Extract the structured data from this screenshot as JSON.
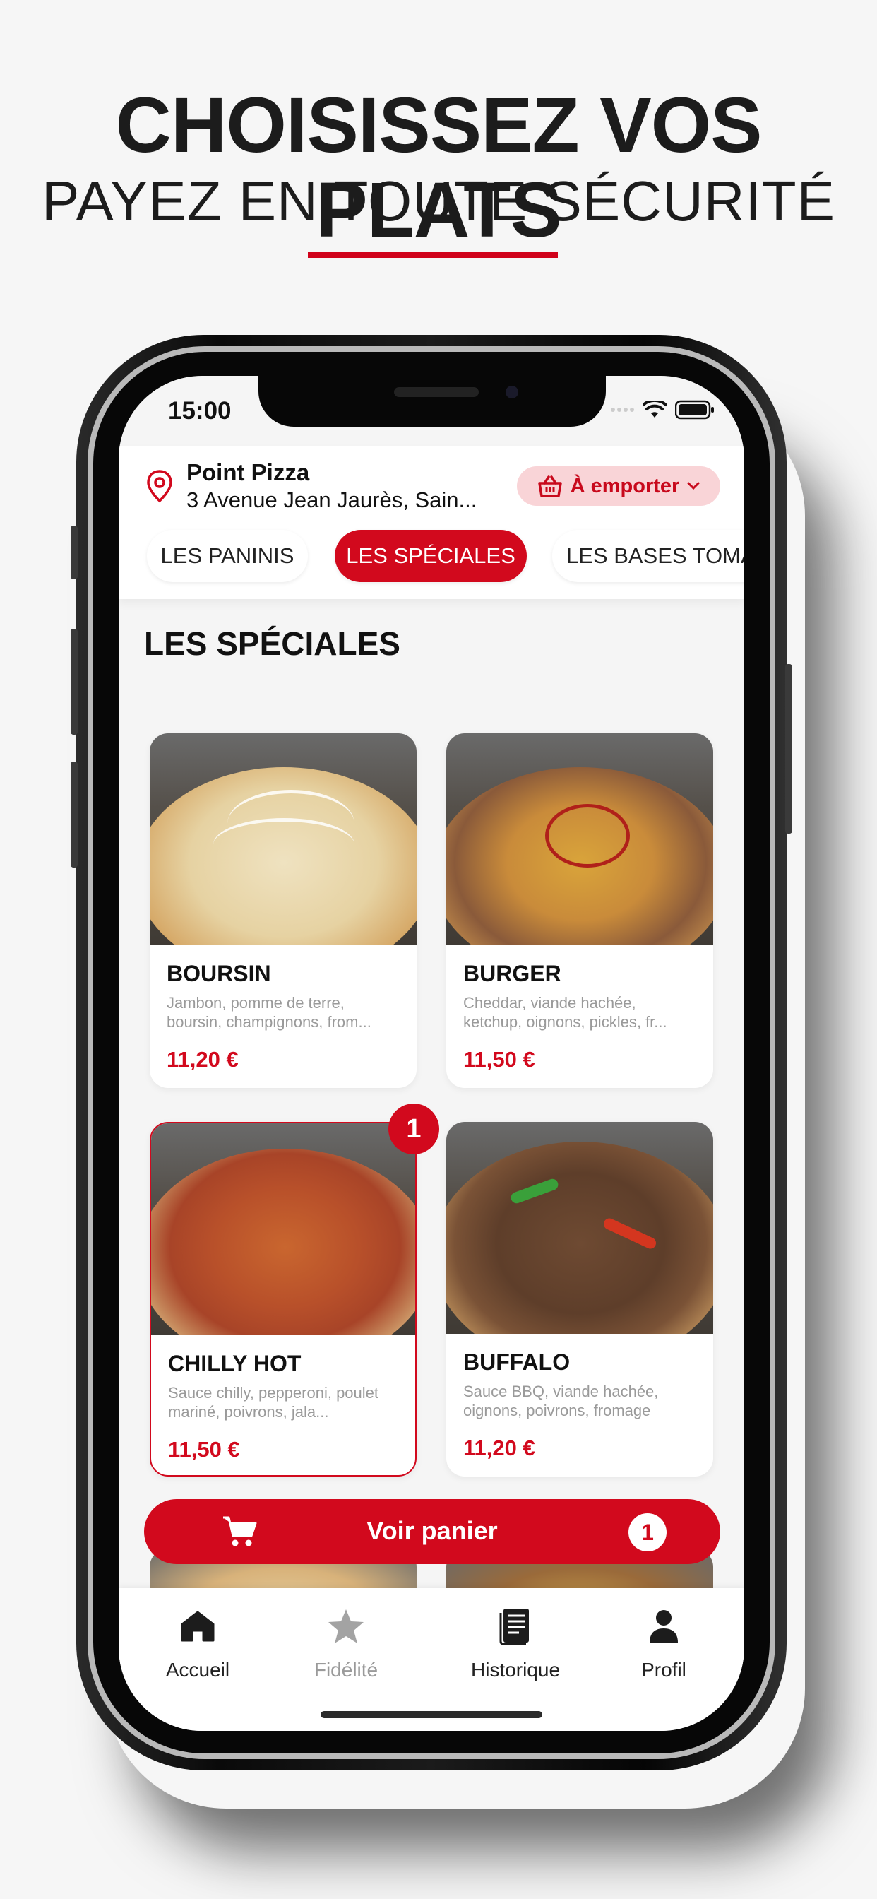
{
  "promo": {
    "headline": "CHOISISSEZ VOS PLATS",
    "subline": "PAYEZ EN TOUTE SÉCURITÉ"
  },
  "status_bar": {
    "time": "15:00"
  },
  "store": {
    "name": "Point Pizza",
    "address": "3 Avenue Jean Jaurès, Sain..."
  },
  "mode_selector": {
    "label": "À emporter"
  },
  "category_tabs": [
    {
      "label": "LES PANINIS",
      "active": false
    },
    {
      "label": "LES SPÉCIALES",
      "active": true
    },
    {
      "label": "LES BASES TOMATE",
      "active": false
    }
  ],
  "section": {
    "title": "LES SPÉCIALES"
  },
  "products": [
    {
      "name": "BOURSIN",
      "description": "Jambon, pomme de terre, boursin, champignons, from...",
      "price": "11,20 €"
    },
    {
      "name": "BURGER",
      "description": "Cheddar, viande hachée, ketchup, oignons, pickles, fr...",
      "price": "11,50 €"
    },
    {
      "name": "CHILLY HOT",
      "description": "Sauce chilly, pepperoni, poulet mariné, poivrons, jala...",
      "price": "11,50 €",
      "quantity": "1"
    },
    {
      "name": "BUFFALO",
      "description": "Sauce BBQ, viande hachée, oignons, poivrons, fromage",
      "price": "11,20 €"
    }
  ],
  "cart": {
    "label": "Voir panier",
    "count": "1"
  },
  "bottom_nav": [
    {
      "label": "Accueil",
      "icon": "home-icon"
    },
    {
      "label": "Fidélité",
      "icon": "star-icon"
    },
    {
      "label": "Historique",
      "icon": "receipt-icon"
    },
    {
      "label": "Profil",
      "icon": "user-icon"
    }
  ],
  "colors": {
    "brand_red": "#d2091d",
    "mode_bg": "#f9d4d7",
    "price_red": "#d2091d"
  }
}
